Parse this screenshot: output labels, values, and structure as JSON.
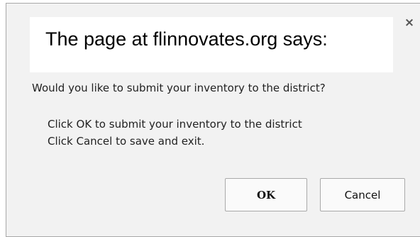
{
  "dialog": {
    "title": "The page at flinnovates.org says:",
    "close_symbol": "×",
    "close_icon": "close-icon",
    "question": "Would you like to submit your inventory to the district?",
    "detail_lines": [
      "Click OK to submit your inventory to the district",
      "Click Cancel to save and exit."
    ],
    "buttons": {
      "ok_label": "OK",
      "cancel_label": "Cancel"
    }
  }
}
